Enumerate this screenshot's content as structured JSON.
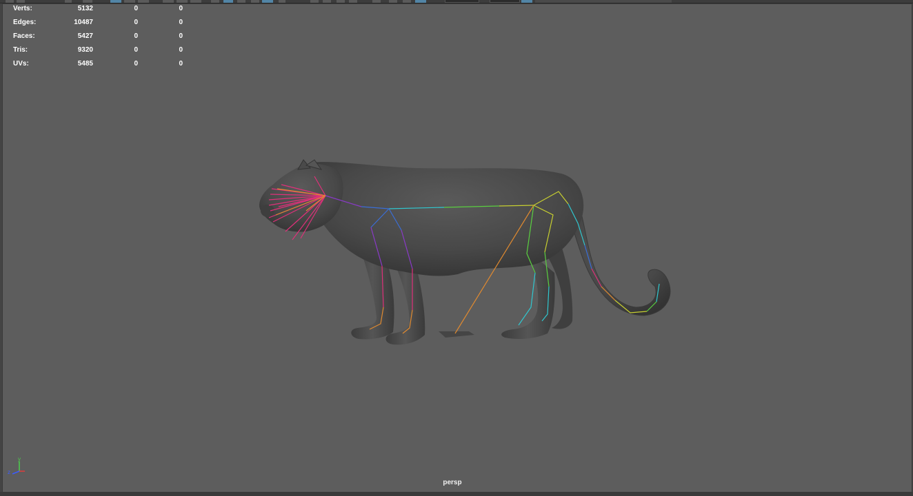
{
  "hud": {
    "rows": [
      {
        "label": "Verts:",
        "v1": "5132",
        "v2": "0",
        "v3": "0"
      },
      {
        "label": "Edges:",
        "v1": "10487",
        "v2": "0",
        "v3": "0"
      },
      {
        "label": "Faces:",
        "v1": "5427",
        "v2": "0",
        "v3": "0"
      },
      {
        "label": "Tris:",
        "v1": "9320",
        "v2": "0",
        "v3": "0"
      },
      {
        "label": "UVs:",
        "v1": "5485",
        "v2": "0",
        "v3": "0"
      }
    ]
  },
  "viewport": {
    "camera_label": "persp",
    "background_color": "#5d5d5d"
  },
  "axis_gizmo": {
    "y_label": "y",
    "z_label": "z",
    "x_color": "#e03c3c",
    "y_color": "#4cd04c",
    "z_color": "#3c5cff"
  },
  "model": {
    "icon": "jaguar-mesh-with-skeleton-icon",
    "joint_colors": [
      "#e0307a",
      "#8a3ac8",
      "#3a6ed8",
      "#30c8d0",
      "#5ad040",
      "#c8d030",
      "#e08a30"
    ]
  }
}
